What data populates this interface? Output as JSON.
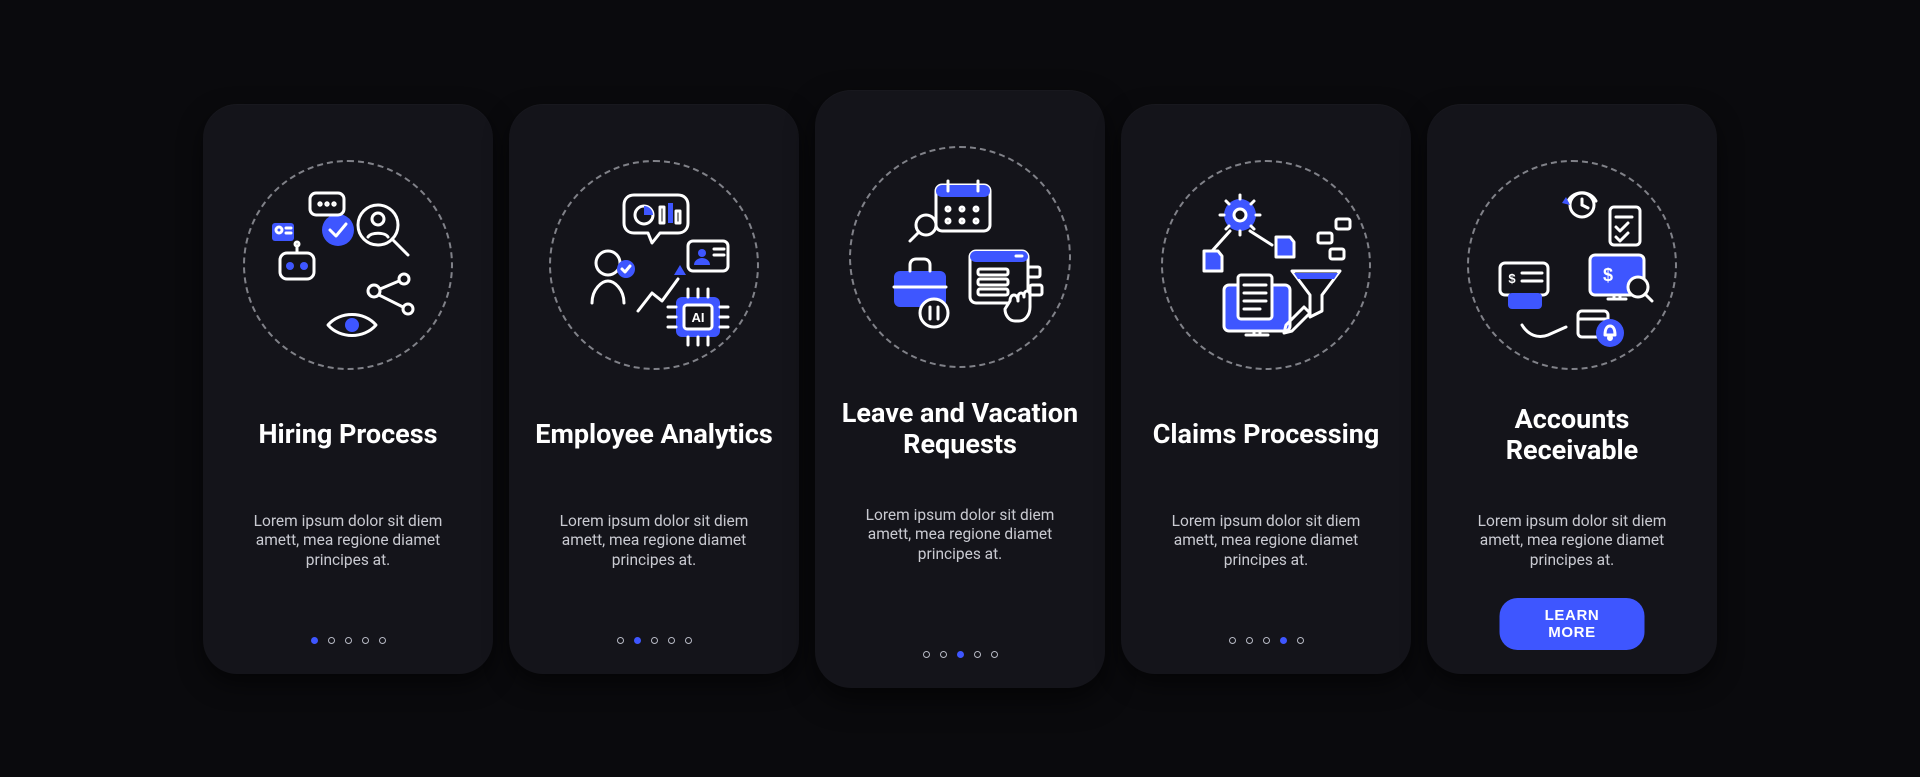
{
  "accent": "#3e56ff",
  "slides": [
    {
      "id": "hiring-process",
      "title": "Hiring Process",
      "description": "Lorem ipsum dolor sit diem amett, mea regione diamet principes at.",
      "icon": "hiring-icon",
      "active_index": 0,
      "total_dots": 5
    },
    {
      "id": "employee-analytics",
      "title": "Employee Analytics",
      "description": "Lorem ipsum dolor sit diem amett, mea regione diamet principes at.",
      "icon": "analytics-icon",
      "active_index": 1,
      "total_dots": 5
    },
    {
      "id": "leave-vacation",
      "title": "Leave and Vacation Requests",
      "description": "Lorem ipsum dolor sit diem amett, mea regione diamet principes at.",
      "icon": "vacation-icon",
      "active_index": 2,
      "total_dots": 5,
      "highlighted": true
    },
    {
      "id": "claims-processing",
      "title": "Claims Processing",
      "description": "Lorem ipsum dolor sit diem amett, mea regione diamet principes at.",
      "icon": "claims-icon",
      "active_index": 3,
      "total_dots": 5
    },
    {
      "id": "accounts-receivable",
      "title": "Accounts Receivable",
      "description": "Lorem ipsum dolor sit diem amett, mea regione diamet principes at.",
      "icon": "receivable-icon",
      "active_index": 4,
      "total_dots": 5,
      "cta_label": "LEARN MORE"
    }
  ]
}
